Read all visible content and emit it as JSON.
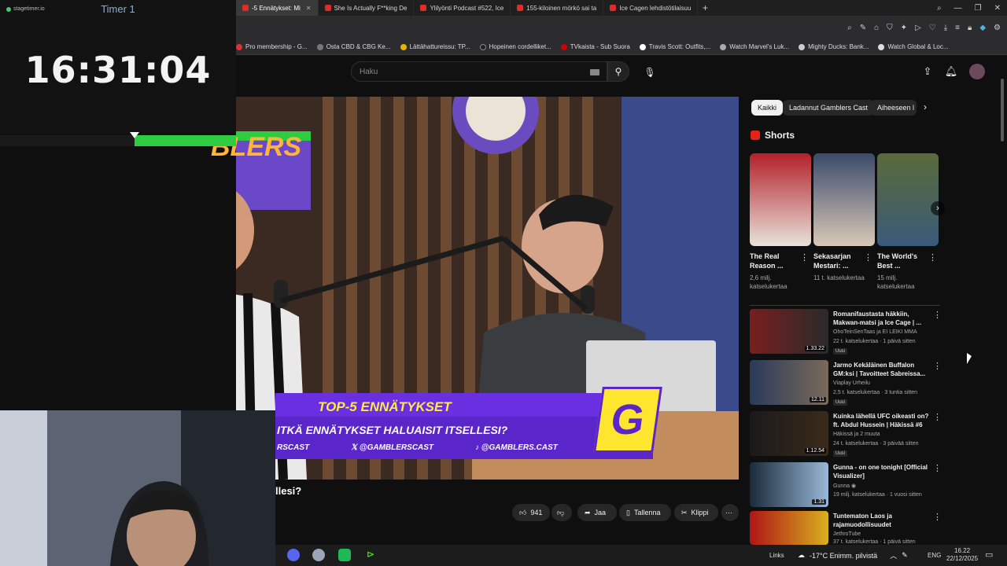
{
  "overlay": {
    "stagetimer_logo": "stagetimer.io",
    "timer_label": "Timer 1",
    "timer_value": "16:31:04",
    "progress_fraction": 0.43
  },
  "browser": {
    "tabs": [
      {
        "label": "-5 Ennätykset: Mi",
        "active": true
      },
      {
        "label": "She Is Actually F**king De"
      },
      {
        "label": "Ylilyönti Podcast #522, Ice"
      },
      {
        "label": "155-kiloinen mörkö sai ta"
      },
      {
        "label": "Ice Cagen lehdistötilaisuu"
      }
    ],
    "add_tab": "+",
    "bookmarks": [
      "Pro membership - G...",
      "Osta CBD & CBG Ke...",
      "Lättähattureissu: TP...",
      "Hopeinen cordelliket...",
      "TVkaista - Sub Suora",
      "Travis Scott: Outfits,...",
      "Watch Marvel's Luk...",
      "Mighty Ducks: Bank...",
      "Watch Global & Loc..."
    ]
  },
  "youtube": {
    "search_placeholder": "Haku",
    "video": {
      "lower_third_title": "TOP-5 ENNÄTYKSET",
      "lower_third_question": "ITKÄ ENNÄTYKSET HALUAISIT ITSELLESI?",
      "social_1": "RSCAST",
      "social_2": "@GAMBLERSCAST",
      "social_3": "@GAMBLERS.CAST",
      "banner_text": "BLERS",
      "logo_letter": "G",
      "title_fragment": "llesi?"
    },
    "actions": {
      "likes": "941",
      "share": "Jaa",
      "save": "Tallenna",
      "clip": "Klippi",
      "more": "⋯"
    },
    "chips": [
      "Kaikki",
      "Ladannut Gamblers Cast",
      "Aiheeseen l"
    ],
    "shorts_heading": "Shorts",
    "shorts": [
      {
        "title": "The Real Reason ...",
        "views": "2,6 milj. katselukertaa"
      },
      {
        "title": "Sekasarjan Mestari: ...",
        "views": "11 t. katselukertaa"
      },
      {
        "title": "The World's Best ...",
        "views": "15 milj. katselukertaa"
      }
    ],
    "recommended": [
      {
        "title": "Romanifaustasta häkkiin, Makwan-matsi ja Ice Cage | ...",
        "channel": "OhoTeinSenTaas ja EI LEIKI MMA",
        "meta": "22 t. katselukertaa · 1 päivä sitten",
        "badge": "Uusi",
        "duration": "1.33.22"
      },
      {
        "title": "Jarmo Kekäläinen Buffalon GM:ksi | Tavoitteet Sabreissa...",
        "channel": "Viaplay Urheilu",
        "meta": "2,5 t. katselukertaa · 3 tuntia sitten",
        "badge": "Uusi",
        "duration": "12.11"
      },
      {
        "title": "Kuinka lähellä UFC oikeasti on? ft. Abdul Hussein | Häkissä #6",
        "channel": "Häkissä ja 2 muuta",
        "meta": "24 t. katselukertaa · 3 päivää sitten",
        "badge": "Uusi",
        "duration": "1.12.54"
      },
      {
        "title": "Gunna - on one tonight [Official Visualizer]",
        "channel": "Gunna ◉",
        "meta": "19 milj. katselukertaa · 1 vuosi sitten",
        "badge": "",
        "duration": "1.31"
      },
      {
        "title": "Tuntematon Laos ja rajamuodollisuudet",
        "channel": "JethroTube",
        "meta": "37 t. katselukertaa · 1 päivä sitten",
        "badge": "",
        "duration": ""
      }
    ]
  },
  "taskbar": {
    "links": "Links",
    "weather": "-17°C  Enimm. pilvistä",
    "lang": "ENG",
    "time": "16.22",
    "date": "22/12/2025"
  },
  "colors": {
    "accent": "#ff0000",
    "progress": "#2ecc40",
    "lower_third": "#5b26c9",
    "logo_yellow": "#ffe62e"
  }
}
